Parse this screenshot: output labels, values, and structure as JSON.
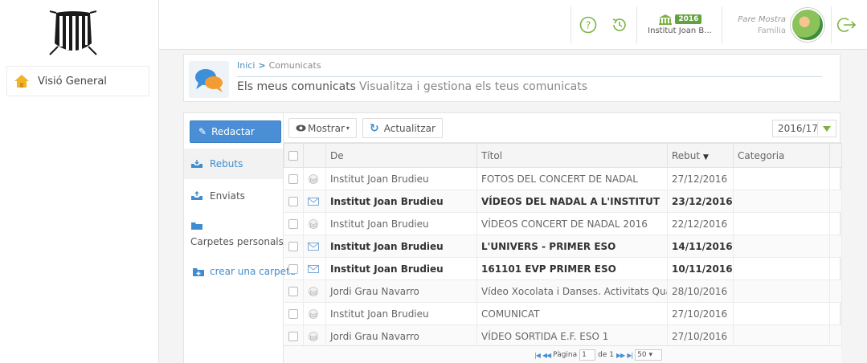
{
  "sidebar": {
    "items": [
      {
        "label": "Visió General",
        "icon": "home-icon"
      }
    ]
  },
  "header": {
    "year_badge": "2016",
    "school_name": "Institut Joan B...",
    "user_name": "Pare Mostra",
    "user_role": "Família"
  },
  "breadcrumb": {
    "home": "Inici",
    "separator": ">",
    "current": "Comunicats"
  },
  "page": {
    "title": "Els meus comunicats",
    "subtitle": "Visualitza i gestiona els teus comunicats"
  },
  "nav": {
    "compose_label": "Redactar",
    "received_label": "Rebuts",
    "sent_label": "Enviats",
    "folders_label": "Carpetes personals",
    "create_folder_label": "crear una carpeta"
  },
  "toolbar": {
    "show_label": "Mostrar",
    "refresh_label": "Actualitzar",
    "year_value": "2016/17"
  },
  "table": {
    "headers": {
      "from": "De",
      "title": "Títol",
      "received": "Rebut",
      "category": "Categoria"
    },
    "rows": [
      {
        "from": "Institut Joan Brudieu",
        "title": "FOTOS DEL CONCERT DE NADAL",
        "date": "27/12/2016",
        "unread": false
      },
      {
        "from": "Institut Joan Brudieu",
        "title": "VÍDEOS DEL NADAL A L'INSTITUT",
        "date": "23/12/2016",
        "unread": true
      },
      {
        "from": "Institut Joan Brudieu",
        "title": "VÍDEOS CONCERT DE NADAL 2016",
        "date": "22/12/2016",
        "unread": false
      },
      {
        "from": "Institut Joan Brudieu",
        "title": "L'UNIVERS - PRIMER ESO",
        "date": "14/11/2016",
        "unread": true
      },
      {
        "from": "Institut Joan Brudieu",
        "title": "161101 EVP PRIMER ESO",
        "date": "10/11/2016",
        "unread": true
      },
      {
        "from": "Jordi Grau Navarro",
        "title": "Vídeo Xocolata i Danses. Activitats Quart E",
        "date": "28/10/2016",
        "unread": false
      },
      {
        "from": "Institut Joan Brudieu",
        "title": "COMUNICAT",
        "date": "27/10/2016",
        "unread": false
      },
      {
        "from": "Jordi Grau Navarro",
        "title": "VÍDEO SORTIDA E.F. ESO 1",
        "date": "27/10/2016",
        "unread": false
      }
    ]
  },
  "pager": {
    "page_label": "Pàgina",
    "page_value": "1",
    "of_label": "de 1",
    "page_size": "50"
  },
  "colors": {
    "accent": "#4a8fd6",
    "badge_green": "#62a33f",
    "link_blue": "#3f8dd0"
  }
}
